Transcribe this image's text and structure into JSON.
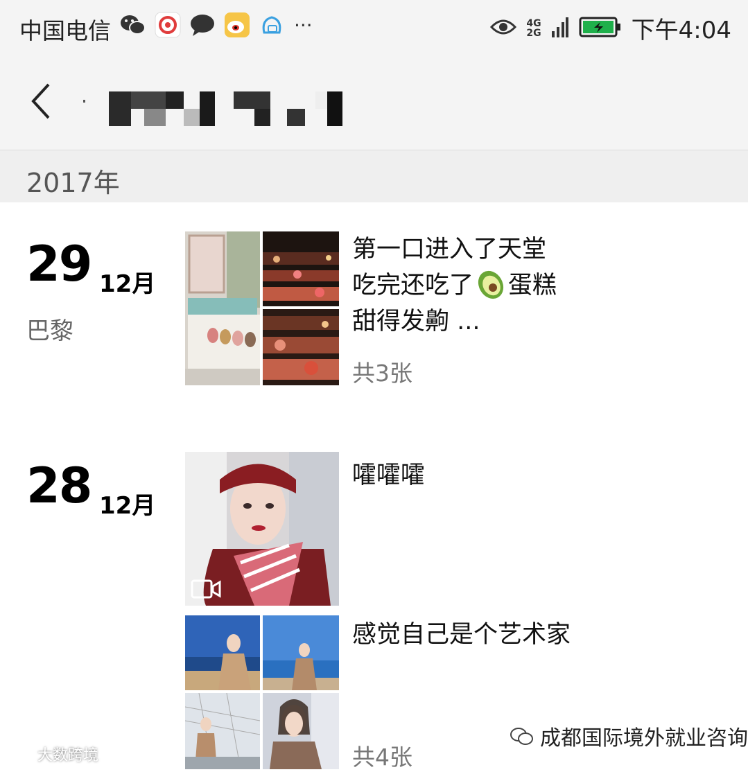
{
  "status_bar": {
    "carrier": "中国电信",
    "network": [
      "4G",
      "2G"
    ],
    "time": "下午4:04",
    "more": "···"
  },
  "nav": {
    "back_icon": "chevron-left-icon"
  },
  "year": "2017年",
  "posts": [
    {
      "day": "29",
      "month": "12月",
      "location": "巴黎",
      "text_lines": [
        "第一口进入了天堂",
        "吃完还吃了",
        "蛋糕",
        "甜得发齁 ..."
      ],
      "count": "共3张"
    },
    {
      "day": "28",
      "month": "12月",
      "text": "嚯嚯嚯"
    },
    {
      "text": "感觉自己是个艺术家",
      "count": "共4张"
    }
  ],
  "watermark": {
    "left": "大数跨境",
    "right": "成都国际境外就业咨询"
  }
}
